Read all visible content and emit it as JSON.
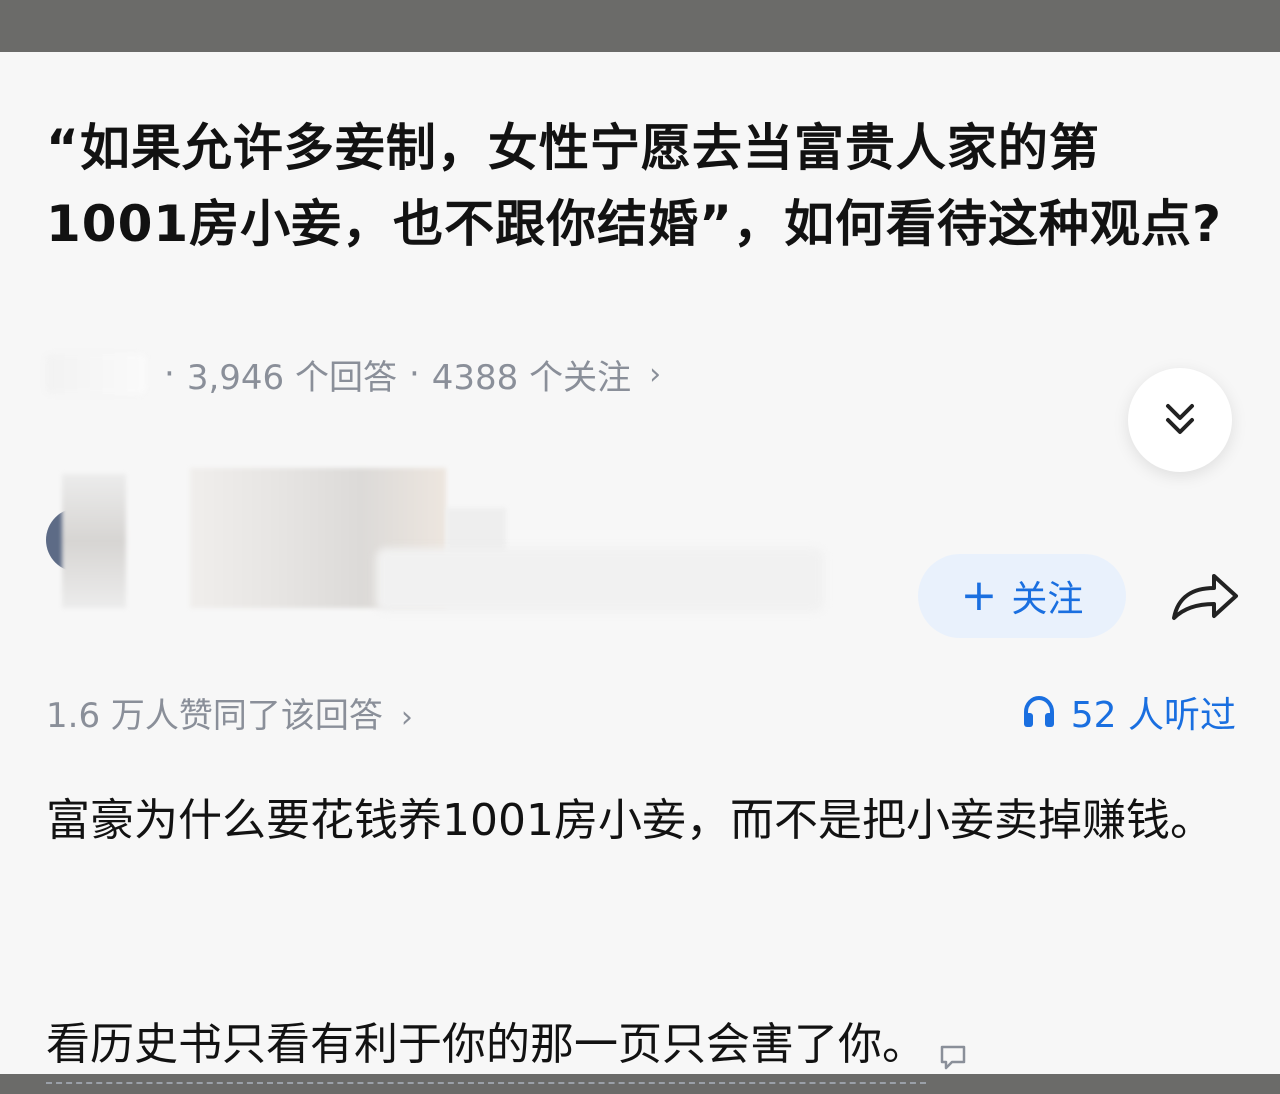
{
  "question": {
    "title": "“如果允许多妾制，女性宁愿去当富贵人家的第1001房小妾，也不跟你结婚”，如何看待这种观点?",
    "answers_count": "3,946 个回答",
    "follows_count": "4388 个关注",
    "separator": "·"
  },
  "author": {
    "follow_label": "关注",
    "follow_plus": "+"
  },
  "stats": {
    "agree_text": "1.6 万人赞同了该回答",
    "listened_text": "52 人听过"
  },
  "answer": {
    "paragraph1": "富豪为什么要花钱养1001房小妾，而不是把小妾卖掉赚钱。",
    "paragraph2": "看历史书只看有利于你的那一页只会害了你。"
  },
  "colors": {
    "accent": "#1a6fe0",
    "follow_bg": "#e9f1fc",
    "muted_text": "#8a8f99",
    "main_text": "#121212"
  },
  "icons": {
    "collapse": "double-chevron-down-icon",
    "share": "share-arrow-icon",
    "listen": "headphones-icon",
    "comment": "comment-bubble-icon"
  }
}
